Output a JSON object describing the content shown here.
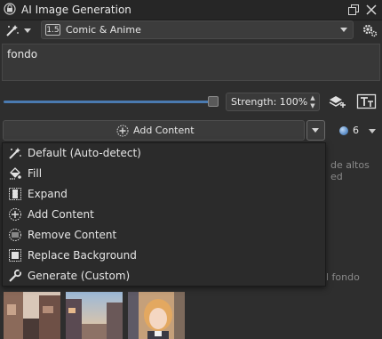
{
  "window": {
    "title": "AI Image Generation"
  },
  "toolbar": {
    "style_badge": "1.5",
    "style_value": "Comic & Anime"
  },
  "prompt": {
    "value": "fondo"
  },
  "strength": {
    "label": "Strength: 100%",
    "value": 1.0
  },
  "action": {
    "label": "Add Content"
  },
  "batch": {
    "value": "6"
  },
  "menu": {
    "items": [
      {
        "label": "Default (Auto-detect)",
        "icon": "wand-icon"
      },
      {
        "label": "Fill",
        "icon": "fill-icon"
      },
      {
        "label": "Expand",
        "icon": "expand-icon"
      },
      {
        "label": "Add Content",
        "icon": "add-content-icon"
      },
      {
        "label": "Remove Content",
        "icon": "remove-content-icon"
      },
      {
        "label": "Replace Background",
        "icon": "replace-background-icon"
      },
      {
        "label": "Generate (Custom)",
        "icon": "wrench-icon"
      }
    ]
  },
  "history": {
    "fragment_1": "de altos ed",
    "fragment_2": "l fondo"
  },
  "colors": {
    "background": "#2e2e2e",
    "accent": "#4a7ab0",
    "menu": "#2b2b2b"
  }
}
